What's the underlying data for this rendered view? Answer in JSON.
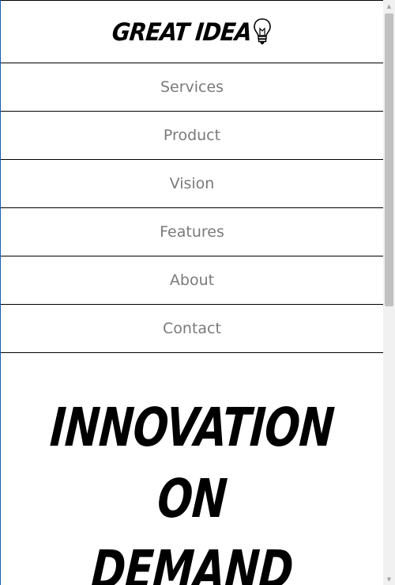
{
  "logo": {
    "text": "GREAT IDEA",
    "icon": "lightbulb-icon"
  },
  "nav": {
    "items": [
      {
        "label": "Services"
      },
      {
        "label": "Product"
      },
      {
        "label": "Vision"
      },
      {
        "label": "Features"
      },
      {
        "label": "About"
      },
      {
        "label": "Contact"
      }
    ]
  },
  "hero": {
    "lines": [
      "INNOVATION",
      "ON",
      "DEMAND"
    ]
  },
  "colors": {
    "nav_text": "#7a7a7a",
    "border": "#000000",
    "scrollbar_track": "#f1f1f1",
    "scrollbar_thumb": "#c1c1c1"
  },
  "scrollbar": {
    "up_icon": "triangle-up-icon",
    "down_icon": "triangle-down-icon"
  }
}
